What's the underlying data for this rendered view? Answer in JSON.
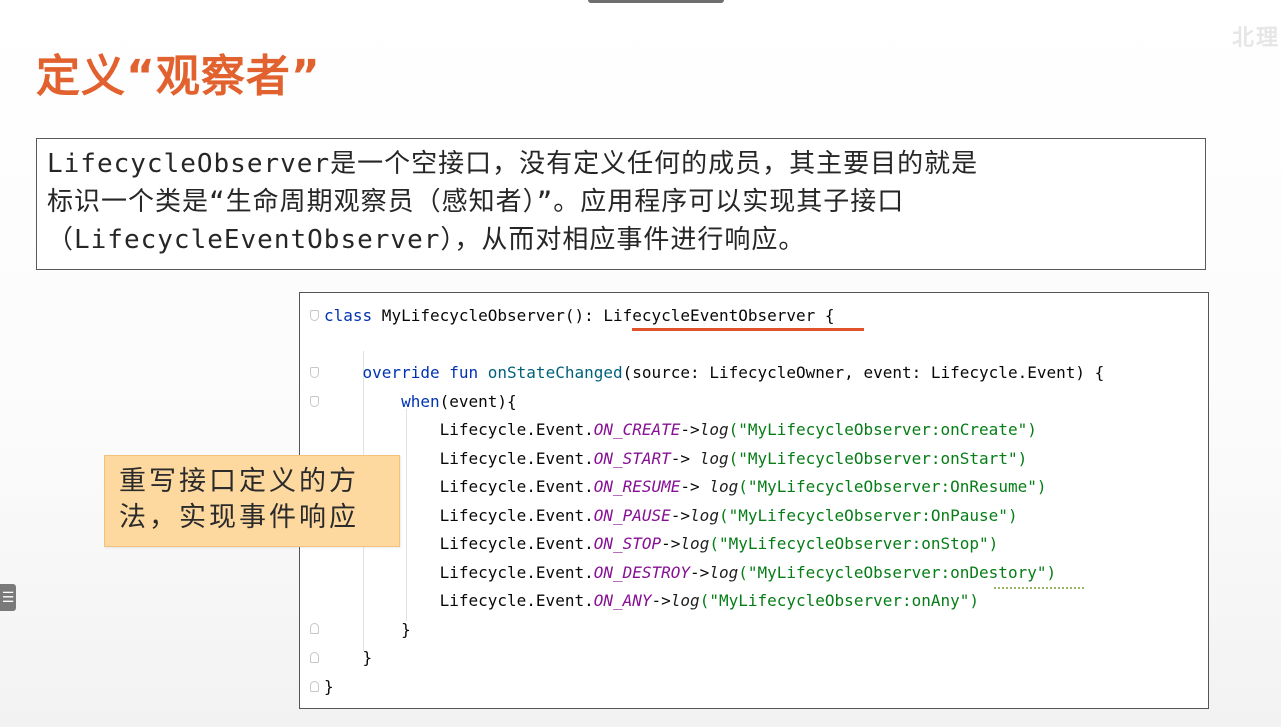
{
  "slide": {
    "title": "定义“观察者”",
    "watermark": "北理"
  },
  "description": {
    "lines": [
      "LifecycleObserver是一个空接口，没有定义任何的成员，其主要目的就是",
      "标识一个类是“生命周期观察员（感知者）”。应用程序可以实现其子接口",
      "（LifecycleEventObserver），从而对相应事件进行响应。"
    ]
  },
  "code": {
    "line1": {
      "kw": "class",
      "name": " MyLifecycleObserver(): ",
      "iface": "LifecycleEventObserver",
      "brace": " {"
    },
    "line3": {
      "indent": "    ",
      "kw": "override fun",
      "sp": " ",
      "fn": "onStateChanged",
      "params": "(source: LifecycleOwner, event: Lifecycle.Event) {"
    },
    "line4": {
      "indent": "        ",
      "kw": "when",
      "rest": "(event){"
    },
    "events": [
      {
        "prefix": "            Lifecycle.Event.",
        "name": "ON_CREATE",
        "arrow": "->",
        "log": "log",
        "arg": "(\"MyLifecycleObserver:onCreate\")"
      },
      {
        "prefix": "            Lifecycle.Event.",
        "name": "ON_START",
        "arrow": "-> ",
        "log": "log",
        "arg": "(\"MyLifecycleObserver:onStart\")"
      },
      {
        "prefix": "            Lifecycle.Event.",
        "name": "ON_RESUME",
        "arrow": "-> ",
        "log": "log",
        "arg": "(\"MyLifecycleObserver:OnResume\")"
      },
      {
        "prefix": "            Lifecycle.Event.",
        "name": "ON_PAUSE",
        "arrow": "->",
        "log": "log",
        "arg": "(\"MyLifecycleObserver:OnPause\")"
      },
      {
        "prefix": "            Lifecycle.Event.",
        "name": "ON_STOP",
        "arrow": "->",
        "log": "log",
        "arg": "(\"MyLifecycleObserver:onStop\")"
      },
      {
        "prefix": "            Lifecycle.Event.",
        "name": "ON_DESTROY",
        "arrow": "->",
        "log": "log",
        "arg": "(\"MyLifecycleObserver:onDestory\")"
      },
      {
        "prefix": "            Lifecycle.Event.",
        "name": "ON_ANY",
        "arrow": "->",
        "log": "log",
        "arg": "(\"MyLifecycleObserver:onAny\")"
      }
    ],
    "close_when": "        }",
    "close_fun": "    }",
    "close_class": "}"
  },
  "callout": {
    "line1": "重写接口定义的方",
    "line2": "法，实现事件响应"
  },
  "menu_button": {
    "glyph": "☰",
    "icon": "menu-icon"
  },
  "colors": {
    "title": "#e2622f",
    "keyword": "#0033b3",
    "function": "#00627a",
    "constant": "#871094",
    "string": "#067d17",
    "callout_bg": "#fdd9a0",
    "underline": "#e0532b"
  }
}
